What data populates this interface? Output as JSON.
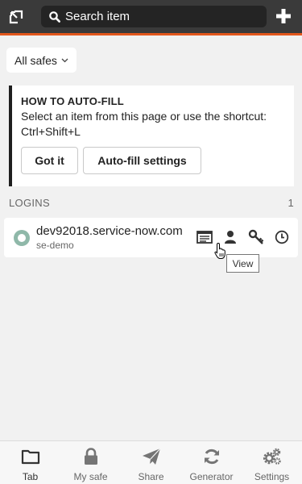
{
  "header": {
    "search_placeholder": "Search item",
    "colors": {
      "bar": "#3a3a3a",
      "accent": "#e2571c"
    }
  },
  "filter": {
    "safes_label": "All safes"
  },
  "help_card": {
    "title": "HOW TO AUTO-FILL",
    "body": "Select an item from this page or use the shortcut: Ctrl+Shift+L",
    "got_it_label": "Got it",
    "settings_label": "Auto-fill settings"
  },
  "logins": {
    "section_label": "LOGINS",
    "count": "1",
    "items": [
      {
        "title": "dev92018.service-now.com",
        "subtitle": "se-demo"
      }
    ],
    "tooltip": "View"
  },
  "bottom_nav": {
    "items": [
      {
        "label": "Tab",
        "icon": "folder-icon"
      },
      {
        "label": "My safe",
        "icon": "lock-icon"
      },
      {
        "label": "Share",
        "icon": "paper-plane-icon"
      },
      {
        "label": "Generator",
        "icon": "refresh-icon"
      },
      {
        "label": "Settings",
        "icon": "gears-icon"
      }
    ]
  }
}
